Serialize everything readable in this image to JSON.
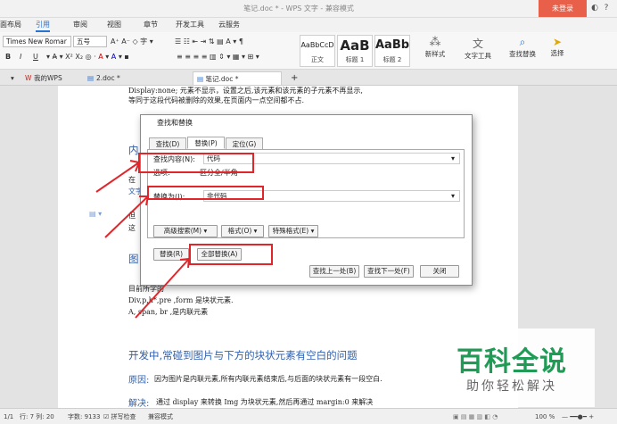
{
  "window": {
    "title": "笔记.doc * - WPS 文字 - 兼容模式",
    "login_label": "未登录"
  },
  "ribbon_tabs": [
    "面布局",
    "引用",
    "审阅",
    "视图",
    "章节",
    "开发工具",
    "云服务"
  ],
  "ribbon_active_tab": "引用",
  "ribbon": {
    "font_name": "Times New Romar",
    "font_size": "五号",
    "bold": "B",
    "italic": "I",
    "underline": "U",
    "styles": [
      {
        "preview": "AaBbCcD",
        "label": "正文"
      },
      {
        "preview": "AaB",
        "label": "标题 1"
      },
      {
        "preview": "AaBb",
        "label": "标题 2"
      }
    ],
    "new_style_label": "新样式",
    "text_tool_label": "文字工具",
    "find_replace_label": "查找替换",
    "select_label": "选择"
  },
  "doc_tabs": [
    {
      "label": "我的WPS"
    },
    {
      "label": "2.doc *"
    },
    {
      "label": "笔记.doc *"
    }
  ],
  "document": {
    "line1": "Display:none; 元素不显示，设置之后,该元素和该元素的子元素不再显示,",
    "line2": "等同于这段代码被删除的效果,在页面内一点空间都不占.",
    "frag_heading": "内",
    "frag_a": "在",
    "frag_b": "文字",
    "frag_c": "但",
    "frag_d": "这",
    "frag_e": "图",
    "body1": "目前所学的",
    "body2": "Div,p,h*,pre ,form 是块状元素.",
    "body3": "A, span, br ,是内联元素",
    "heading2": "开发中,常碰到图片与下方的块状元素有空白的问题",
    "reason_label": "原因:",
    "reason_text": "因为图片是内联元素,所有内联元素结束后,与后面的块状元素有一段空白.",
    "solution_label": "解决:",
    "solution_text": "通过 display 来转换 Img 为块状元素,然后再通过 margin:0 来解决"
  },
  "dialog": {
    "title": "查找和替换",
    "tabs": [
      "查找(D)",
      "替换(P)",
      "定位(G)"
    ],
    "active_tab": "替换(P)",
    "find_label": "查找内容(N):",
    "find_value": "代码",
    "options_label": "选项:",
    "options_value": "区分全/半角",
    "replace_label": "替换为(I):",
    "replace_value": "非代码",
    "advanced_button": "高级搜索(M)",
    "format_button": "格式(O)",
    "special_button": "特殊格式(E)",
    "replace_button": "替换(R)",
    "replace_all_button": "全部替换(A)",
    "find_prev_button": "查找上一处(B)",
    "find_next_button": "查找下一处(F)",
    "close_button": "关闭"
  },
  "statusbar": {
    "page": "1/1",
    "position": "行: 7  列: 20",
    "word_count": "字数: 9133",
    "spell": "拼写检查",
    "mode": "兼容模式",
    "zoom": "100 %"
  },
  "watermark": {
    "main": "百科全说",
    "sub": "助你轻松解决"
  },
  "colors": {
    "accent": "#2a73d0",
    "annotation": "#e0262b",
    "login": "#e8604a",
    "watermark": "#1f9b55"
  }
}
